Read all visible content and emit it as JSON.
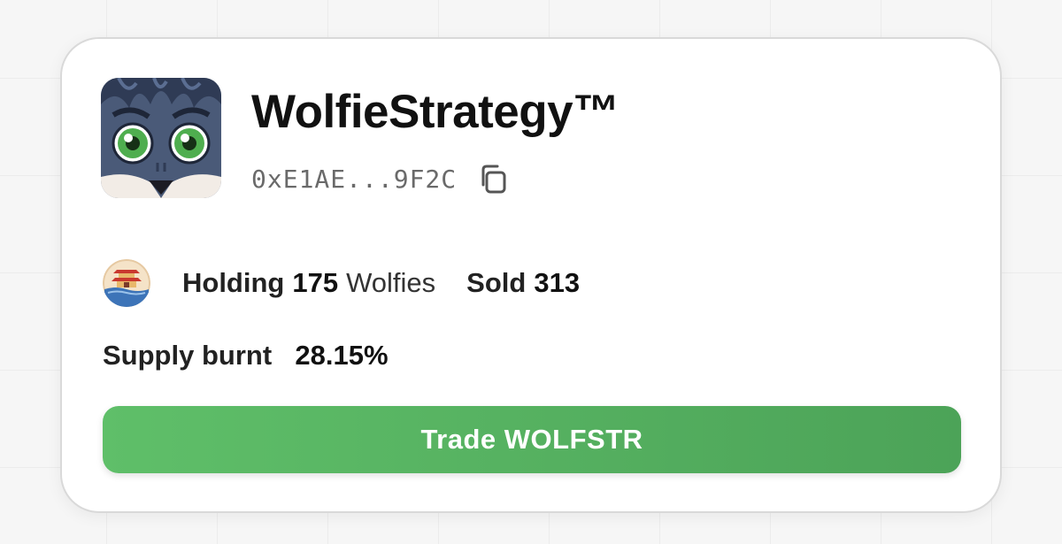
{
  "token": {
    "name": "WolfieStrategy™",
    "address_short": "0xE1AE...9F2C",
    "avatar_icon": "wolf-avatar-icon",
    "copy_icon": "copy-icon"
  },
  "holdings": {
    "holding_label": "Holding",
    "holding_count": "175",
    "holding_unit": "Wolfies",
    "sold_label": "Sold",
    "sold_count": "313",
    "holder_icon": "pagoda-avatar-icon"
  },
  "supply": {
    "label": "Supply burnt",
    "value": "28.15%"
  },
  "trade_button": {
    "label": "Trade WOLFSTR",
    "color_start": "#5fbf69",
    "color_end": "#4ca358"
  },
  "colors": {
    "card_background": "#ffffff",
    "card_border": "#d9d9d9",
    "address_text": "#6a6a6a"
  }
}
